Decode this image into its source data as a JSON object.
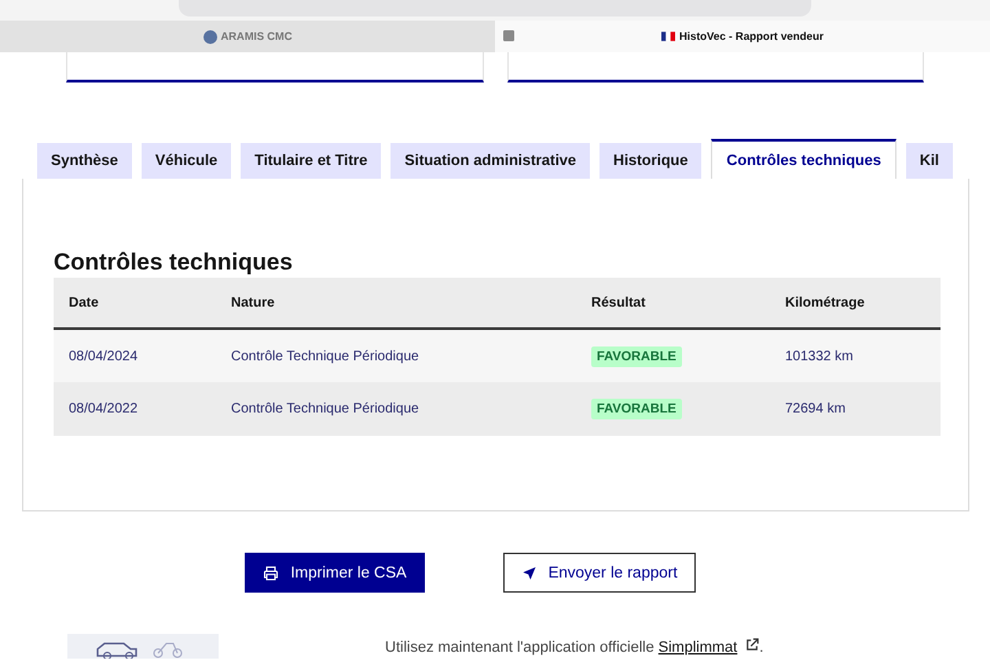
{
  "browser_tabs": [
    {
      "label": "ARAMIS CMC",
      "selected": false
    },
    {
      "label": "HistoVec - Rapport vendeur",
      "selected": true
    }
  ],
  "tabs": [
    {
      "label": "Synthèse",
      "selected": false
    },
    {
      "label": "Véhicule",
      "selected": false
    },
    {
      "label": "Titulaire et Titre",
      "selected": false
    },
    {
      "label": "Situation administrative",
      "selected": false
    },
    {
      "label": "Historique",
      "selected": false
    },
    {
      "label": "Contrôles techniques",
      "selected": true
    },
    {
      "label": "Kil",
      "selected": false
    }
  ],
  "section": {
    "title": "Contrôles techniques",
    "table": {
      "columns": [
        "Date",
        "Nature",
        "Résultat",
        "Kilométrage"
      ],
      "rows": [
        {
          "date": "08/04/2024",
          "nature": "Contrôle Technique Périodique",
          "result": "FAVORABLE",
          "mileage": "101332 km"
        },
        {
          "date": "08/04/2022",
          "nature": "Contrôle Technique Périodique",
          "result": "FAVORABLE",
          "mileage": "72694 km"
        }
      ]
    }
  },
  "buttons": [
    {
      "kind": "primary",
      "label": "Imprimer le CSA"
    },
    {
      "kind": "secondary",
      "label": "Envoyer le rapport"
    }
  ],
  "footer": {
    "text": "Utilisez maintenant l'application officielle",
    "link": "Simplimmat",
    "end": "."
  }
}
